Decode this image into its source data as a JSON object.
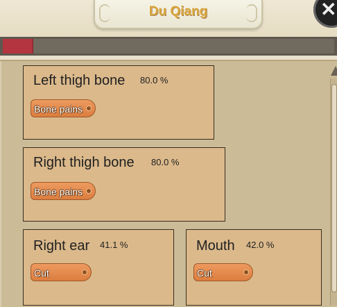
{
  "header": {
    "title": "Du Qiang",
    "close_label": "✕"
  },
  "health": {
    "fill_fraction": 0.09,
    "color": "#b4343f"
  },
  "cards": [
    {
      "part": "Left thigh bone",
      "percent": "80.0 %",
      "ailment": "Bone pains"
    },
    {
      "part": "Right thigh bone",
      "percent": "80.0 %",
      "ailment": "Bone pains"
    },
    {
      "part": "Right ear",
      "percent": "41.1 %",
      "ailment": "Cut"
    },
    {
      "part": "Mouth",
      "percent": "42.0 %",
      "ailment": "Cut"
    }
  ],
  "colors": {
    "card_bg": "#dbb98b",
    "ailment_btn": "#e68a4c",
    "title": "#d9a437"
  }
}
